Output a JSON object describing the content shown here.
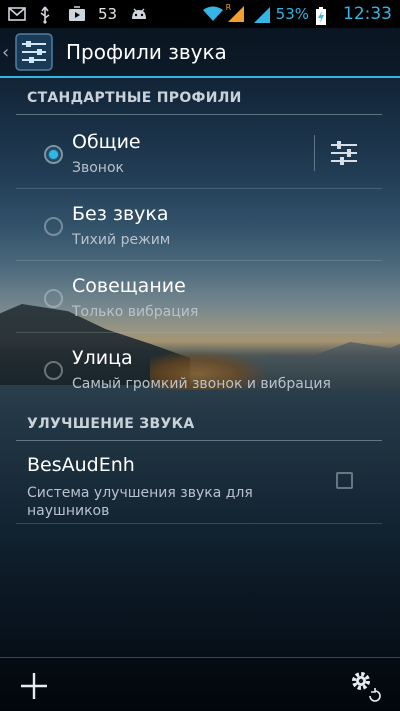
{
  "status_bar": {
    "icons_left": [
      "gmail-icon",
      "usb-icon",
      "play-store-icon",
      "notification-count",
      "android-debug-icon"
    ],
    "notification_count": "53",
    "icons_right": [
      "wifi-icon",
      "signal-roaming-icon",
      "signal-icon"
    ],
    "roaming_marker": "R",
    "battery_percent": "53%",
    "time": "12:33"
  },
  "action_bar": {
    "title": "Профили звука",
    "icon": "sound-profiles-icon"
  },
  "sections": {
    "standard": "СТАНДАРТНЫЕ ПРОФИЛИ",
    "enhancement": "УЛУЧШЕНИЕ ЗВУКА"
  },
  "profiles": [
    {
      "title": "Общие",
      "subtitle": "Звонок",
      "selected": true
    },
    {
      "title": "Без звука",
      "subtitle": "Тихий режим",
      "selected": false
    },
    {
      "title": "Совещание",
      "subtitle": "Только вибрация",
      "selected": false
    },
    {
      "title": "Улица",
      "subtitle": "Самый громкий звонок и вибрация",
      "selected": false
    }
  ],
  "enhancement_item": {
    "title": "BesAudEnh",
    "subtitle": "Система улучшения звука для наушников",
    "checked": false
  },
  "bottom_bar": {
    "add_icon": "add-icon",
    "settings_icon": "settings-reset-icon"
  },
  "colors": {
    "accent": "#33b5e5",
    "status_bar_bg": "#000000"
  }
}
